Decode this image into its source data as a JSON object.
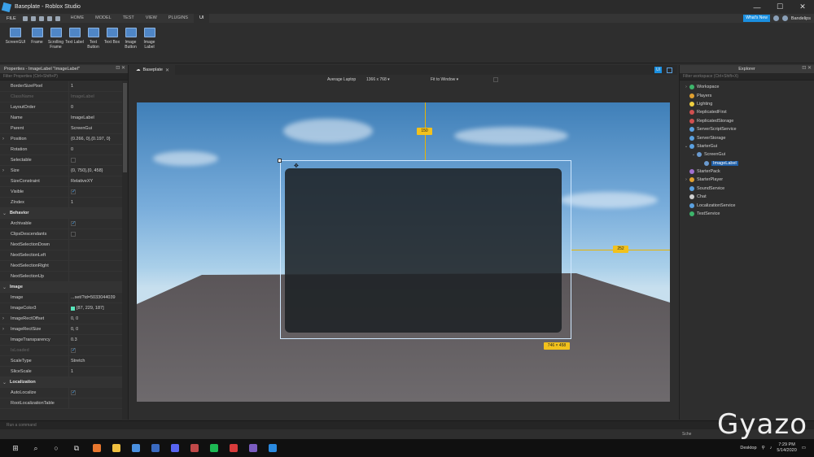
{
  "window": {
    "title": "Baseplate - Roblox Studio",
    "controls": [
      "—",
      "☐",
      "✕"
    ]
  },
  "menu": {
    "file": "FILE",
    "tabs": [
      "HOME",
      "MODEL",
      "TEST",
      "VIEW",
      "PLUGINS",
      "UI"
    ],
    "active_tab": "UI",
    "whats_new": "What's New",
    "username": "Bandelips"
  },
  "ribbon": [
    {
      "label": "ScreenGUI",
      "icon": "screengui-icon"
    },
    {
      "label": "Frame",
      "icon": "frame-icon"
    },
    {
      "label": "Scrolling Frame",
      "icon": "scrolling-frame-icon"
    },
    {
      "label": "Text Label",
      "icon": "text-label-icon"
    },
    {
      "label": "Text Button",
      "icon": "text-button-icon"
    },
    {
      "label": "Text Box",
      "icon": "text-box-icon"
    },
    {
      "label": "Image Button",
      "icon": "image-button-icon"
    },
    {
      "label": "Image Label",
      "icon": "image-label-icon"
    }
  ],
  "properties": {
    "title": "Properties - ImageLabel \"ImageLabel\"",
    "filter_placeholder": "Filter Properties (Ctrl+Shift+P)",
    "rows": [
      {
        "name": "BorderSizePixel",
        "value": "1"
      },
      {
        "name": "ClassName",
        "value": "ImageLabel",
        "dim": true
      },
      {
        "name": "LayoutOrder",
        "value": "0"
      },
      {
        "name": "Name",
        "value": "ImageLabel"
      },
      {
        "name": "Parent",
        "value": "ScreenGui"
      },
      {
        "name": "Position",
        "value": "{0.266, 0},{0.197, 0}",
        "expand": true
      },
      {
        "name": "Rotation",
        "value": "0"
      },
      {
        "name": "Selectable",
        "value": "",
        "check": "off"
      },
      {
        "name": "Size",
        "value": "{0, 750},{0, 458}",
        "expand": true
      },
      {
        "name": "SizeConstraint",
        "value": "RelativeXY"
      },
      {
        "name": "Visible",
        "value": "",
        "check": "on"
      },
      {
        "name": "ZIndex",
        "value": "1"
      },
      {
        "name": "Behavior",
        "section": true
      },
      {
        "name": "Archivable",
        "value": "",
        "check": "on"
      },
      {
        "name": "ClipsDescendants",
        "value": "",
        "check": "off"
      },
      {
        "name": "NextSelectionDown",
        "value": ""
      },
      {
        "name": "NextSelectionLeft",
        "value": ""
      },
      {
        "name": "NextSelectionRight",
        "value": ""
      },
      {
        "name": "NextSelectionUp",
        "value": ""
      },
      {
        "name": "Image",
        "section": true
      },
      {
        "name": "Image",
        "value": "...set/?id=5033044039"
      },
      {
        "name": "ImageColor3",
        "value": "[87, 229, 187]",
        "swatch": "#57e5bb"
      },
      {
        "name": "ImageRectOffset",
        "value": "0, 0",
        "expand": true
      },
      {
        "name": "ImageRectSize",
        "value": "0, 0",
        "expand": true
      },
      {
        "name": "ImageTransparency",
        "value": "0.3"
      },
      {
        "name": "IsLoaded",
        "value": "",
        "check": "on",
        "dim": true
      },
      {
        "name": "ScaleType",
        "value": "Stretch"
      },
      {
        "name": "SliceScale",
        "value": "1"
      },
      {
        "name": "Localization",
        "section": true
      },
      {
        "name": "AutoLocalize",
        "value": "",
        "check": "on"
      },
      {
        "name": "RootLocalizationTable",
        "value": ""
      }
    ]
  },
  "viewport": {
    "tab": "Baseplate",
    "ui_button": "UI",
    "device": "Average Laptop",
    "resolution": "1366 x 768",
    "fit": "Fit to Window",
    "guide_top": "150",
    "guide_right": "252",
    "size_readout": "746 × 458"
  },
  "explorer": {
    "title": "Explorer",
    "filter_placeholder": "Filter workspace (Ctrl+Shift+X)",
    "items": [
      {
        "label": "Workspace",
        "depth": 0,
        "arrow": "›",
        "color": "#3db56b"
      },
      {
        "label": "Players",
        "depth": 0,
        "arrow": "",
        "color": "#e0a030"
      },
      {
        "label": "Lighting",
        "depth": 0,
        "arrow": "",
        "color": "#f0d040"
      },
      {
        "label": "ReplicatedFirst",
        "depth": 0,
        "arrow": "",
        "color": "#d05050"
      },
      {
        "label": "ReplicatedStorage",
        "depth": 0,
        "arrow": "",
        "color": "#d05050"
      },
      {
        "label": "ServerScriptService",
        "depth": 0,
        "arrow": "",
        "color": "#5aa0e0"
      },
      {
        "label": "ServerStorage",
        "depth": 0,
        "arrow": "",
        "color": "#5aa0e0"
      },
      {
        "label": "StarterGui",
        "depth": 0,
        "arrow": "⌄",
        "color": "#5aa0e0"
      },
      {
        "label": "ScreenGui",
        "depth": 1,
        "arrow": "⌄",
        "color": "#6a9ad0"
      },
      {
        "label": "ImageLabel",
        "depth": 2,
        "arrow": "",
        "color": "#6a9ad0",
        "selected": true
      },
      {
        "label": "StarterPack",
        "depth": 0,
        "arrow": "",
        "color": "#a070d0"
      },
      {
        "label": "StarterPlayer",
        "depth": 0,
        "arrow": "›",
        "color": "#e0a030"
      },
      {
        "label": "SoundService",
        "depth": 0,
        "arrow": "",
        "color": "#5aa0e0"
      },
      {
        "label": "Chat",
        "depth": 0,
        "arrow": "",
        "color": "#cfcfcf"
      },
      {
        "label": "LocalizationService",
        "depth": 0,
        "arrow": "",
        "color": "#5aa0e0"
      },
      {
        "label": "TestService",
        "depth": 0,
        "arrow": "",
        "color": "#3db56b"
      }
    ]
  },
  "command_bar": {
    "placeholder": "Run a command"
  },
  "status": {
    "left_text": "Sche"
  },
  "taskbar": {
    "desktop": "Desktop",
    "time": "7:29 PM",
    "date": "5/14/2020"
  },
  "watermark": "Gyazo"
}
